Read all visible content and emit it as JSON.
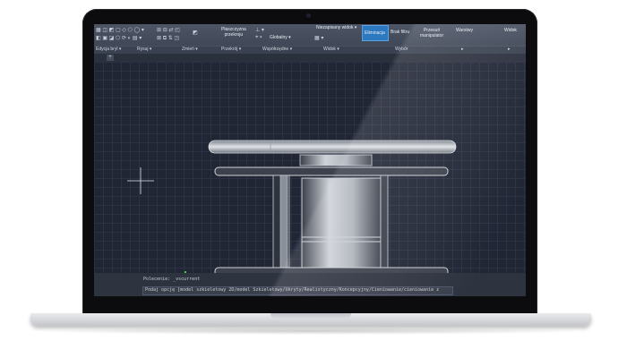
{
  "ribbon": {
    "top_buttons": [
      {
        "label": "Płaszczyzna",
        "label2": "przekroju"
      },
      {
        "label": "Globalny"
      },
      {
        "label": "Niezapisany widok"
      },
      {
        "label": "Eliminacja"
      },
      {
        "label": "Brak filtru"
      },
      {
        "label": "Przesuń",
        "label2": "manipulator"
      },
      {
        "label": "Warstwy"
      },
      {
        "label": "Widok"
      }
    ],
    "panels": [
      "Edycja bryl",
      "Rysuj",
      "Zmień",
      "Przekrój",
      "Współrzędne",
      "Widok",
      "Wybór"
    ],
    "colors": {
      "ribbon_bg": "#434a59",
      "active": "#2c79c0"
    }
  },
  "tabs": {
    "new_tab_icon": "+"
  },
  "viewport": {
    "background": "#212635",
    "grid_color": "#2c3244",
    "cursor_icon": "crosshair-icon",
    "ucs_icon": "ucs-axes-icon",
    "model_color": "#c8ccd2"
  },
  "command": {
    "history": "Polecenie: _vscurrent",
    "prompt": "Podaj opcję [model szkieletowy 2D/model Szkieletowy/Ukryty/Realistyczny/Koncepcyjny/Cieniowanie/cieniowanie z"
  }
}
